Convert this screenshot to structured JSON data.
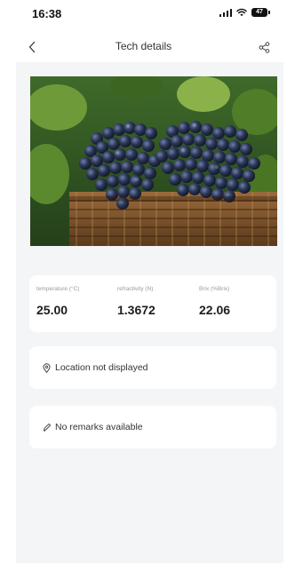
{
  "status_bar": {
    "time": "16:38",
    "battery_level": "47"
  },
  "nav": {
    "title": "Tech details",
    "back_icon": "chevron-left-icon",
    "share_icon": "share-icon"
  },
  "hero": {
    "subject_icon": "photo-grapes-in-basket"
  },
  "metrics": [
    {
      "label": "temperature (°C)",
      "value": "25.00"
    },
    {
      "label": "refractivity (N)",
      "value": "1.3672"
    },
    {
      "label": "Brix (%Brix)",
      "value": "22.06"
    }
  ],
  "location": {
    "icon": "location-pin-icon",
    "text": "Location not displayed"
  },
  "remarks": {
    "icon": "pencil-icon",
    "text": "No remarks available"
  },
  "colors": {
    "panel_background": "#f4f5f7",
    "card_background": "#ffffff",
    "text_primary": "#1d1d1d",
    "text_muted": "#9a9a9a"
  }
}
